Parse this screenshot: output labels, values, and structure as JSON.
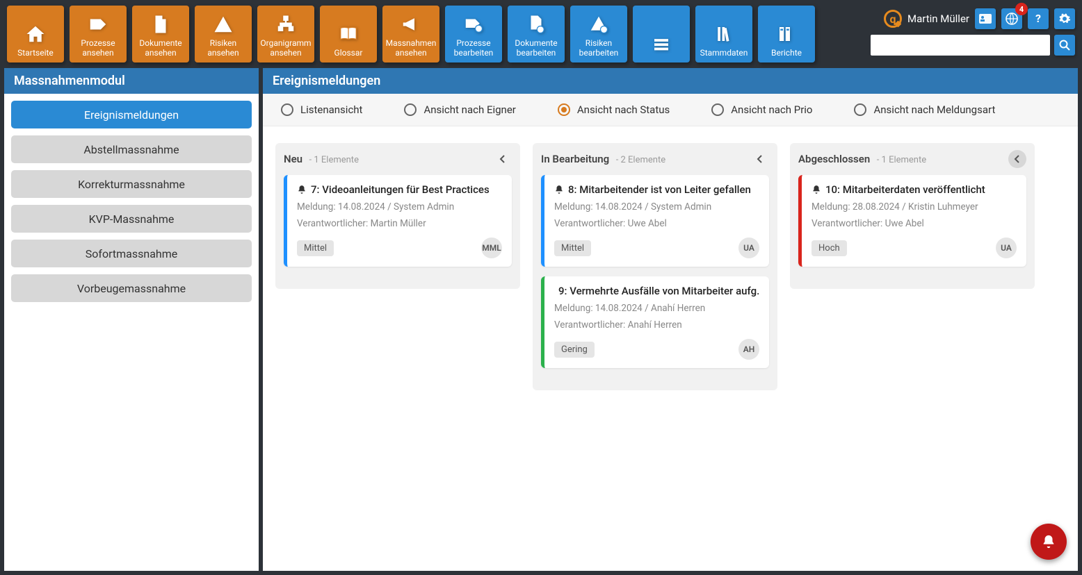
{
  "nav": {
    "orange": [
      {
        "label": "Startseite",
        "icon": "home"
      },
      {
        "label": "Prozesse\nansehen",
        "icon": "tag"
      },
      {
        "label": "Dokumente\nansehen",
        "icon": "doc"
      },
      {
        "label": "Risiken\nansehen",
        "icon": "warn"
      },
      {
        "label": "Organigramm\nansehen",
        "icon": "org"
      },
      {
        "label": "Glossar",
        "icon": "book"
      },
      {
        "label": "Massnahmen\nansehen",
        "icon": "mega"
      }
    ],
    "blue": [
      {
        "label": "Prozesse\nbearbeiten",
        "icon": "tag-gear"
      },
      {
        "label": "Dokumente\nbearbeiten",
        "icon": "doc-gear"
      },
      {
        "label": "Risiken\nbearbeiten",
        "icon": "warn-gear"
      },
      {
        "label": "",
        "icon": "lines"
      },
      {
        "label": "Stammdaten",
        "icon": "books"
      },
      {
        "label": "Berichte",
        "icon": "reports"
      }
    ]
  },
  "user": {
    "name": "Martin Müller",
    "notif_count": "4"
  },
  "search": {
    "placeholder": ""
  },
  "sidebar": {
    "header": "Massnahmenmodul",
    "items": [
      {
        "label": "Ereignismeldungen",
        "active": true
      },
      {
        "label": "Abstellmassnahme",
        "active": false
      },
      {
        "label": "Korrekturmassnahme",
        "active": false
      },
      {
        "label": "KVP-Massnahme",
        "active": false
      },
      {
        "label": "Sofortmassnahme",
        "active": false
      },
      {
        "label": "Vorbeugemassnahme",
        "active": false
      }
    ]
  },
  "content": {
    "header": "Ereignismeldungen",
    "views": [
      {
        "label": "Listenansicht",
        "selected": false
      },
      {
        "label": "Ansicht nach Eigner",
        "selected": false
      },
      {
        "label": "Ansicht nach Status",
        "selected": true
      },
      {
        "label": "Ansicht nach Prio",
        "selected": false
      },
      {
        "label": "Ansicht nach Meldungsart",
        "selected": false
      }
    ],
    "columns": [
      {
        "title": "Neu",
        "count": "- 1 Elemente",
        "collapse_dark": false,
        "cards": [
          {
            "color": "blue",
            "title": "7: Videoanleitungen für Best Practices",
            "line1": "Meldung: 14.08.2024 / System Admin",
            "line2": "Verantwortlicher: Martin Müller",
            "priority": "Mittel",
            "avatar": "MML"
          }
        ]
      },
      {
        "title": "In Bearbeitung",
        "count": "- 2 Elemente",
        "collapse_dark": false,
        "cards": [
          {
            "color": "blue",
            "title": "8: Mitarbeitender ist von Leiter gefallen",
            "line1": "Meldung: 14.08.2024 / System Admin",
            "line2": "Verantwortlicher: Uwe Abel",
            "priority": "Mittel",
            "avatar": "UA"
          },
          {
            "color": "green",
            "title": "9: Vermehrte Ausfälle von Mitarbeiter aufg…",
            "line1": "Meldung: 14.08.2024 / Anahí Herren",
            "line2": "Verantwortlicher: Anahí Herren",
            "priority": "Gering",
            "avatar": "AH"
          }
        ]
      },
      {
        "title": "Abgeschlossen",
        "count": "- 1 Elemente",
        "collapse_dark": true,
        "cards": [
          {
            "color": "red",
            "title": "10: Mitarbeiterdaten veröffentlicht",
            "line1": "Meldung: 28.08.2024 / Kristin Luhmeyer",
            "line2": "Verantwortlicher: Uwe Abel",
            "priority": "Hoch",
            "avatar": "UA"
          }
        ]
      }
    ]
  }
}
